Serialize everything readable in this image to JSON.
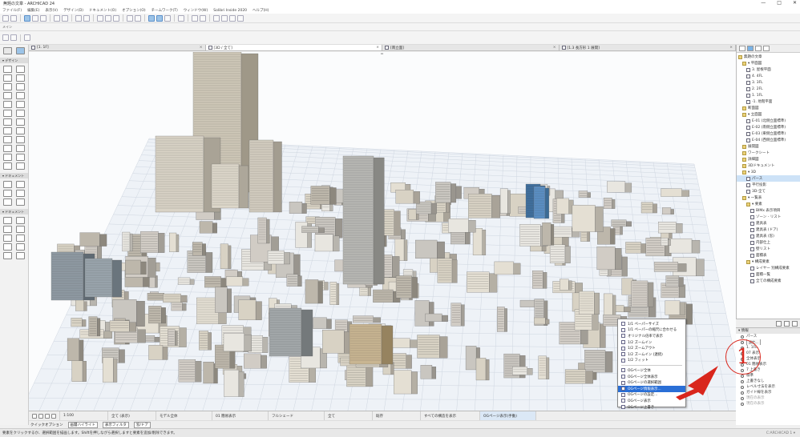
{
  "window": {
    "title": "無題の文章 - ARCHICAD 24",
    "controls": [
      "—",
      "□",
      "✕"
    ]
  },
  "menu": [
    "ファイル(F)",
    "編集(E)",
    "表示(V)",
    "デザイン(D)",
    "ドキュメント(O)",
    "オプション(O)",
    "チームワーク(T)",
    "ウィンドウ(W)",
    "Solibri Inside 2020",
    "ヘルプ(H)"
  ],
  "toolbar_small_label": "メイン",
  "tabs": [
    {
      "label": "[1. 1F]",
      "icon": "floorplan-icon",
      "active": false
    },
    {
      "label": "[3D / 全て]",
      "icon": "3d-icon",
      "active": true
    },
    {
      "label": "[南立面]",
      "icon": "elevation-icon",
      "active": false
    },
    {
      "label": "[1.3 長方形 1 展開]",
      "icon": "interior-elevation-icon",
      "active": false
    }
  ],
  "left_toolbox": {
    "sections": [
      {
        "title": "▾ デザイン",
        "count": 24
      },
      {
        "title": "▾ ドキュメント",
        "count": 6
      },
      {
        "title": "▾ ドキュメント",
        "count": 10
      }
    ]
  },
  "navigator": {
    "items": [
      {
        "label": "無題の文章",
        "indent": 0,
        "icon": "folder",
        "sel": false
      },
      {
        "label": "▾ 平面図",
        "indent": 1,
        "icon": "folder",
        "sel": false
      },
      {
        "label": "3. 屋根平面",
        "indent": 2,
        "icon": "doc",
        "sel": false
      },
      {
        "label": "4. 4FL",
        "indent": 2,
        "icon": "doc",
        "sel": false
      },
      {
        "label": "3. 3FL",
        "indent": 2,
        "icon": "doc",
        "sel": false
      },
      {
        "label": "2. 2FL",
        "indent": 2,
        "icon": "doc",
        "sel": false
      },
      {
        "label": "1. 1FL",
        "indent": 2,
        "icon": "doc",
        "sel": false
      },
      {
        "label": "-1. 地階平面",
        "indent": 2,
        "icon": "doc",
        "sel": false
      },
      {
        "label": "断面図",
        "indent": 1,
        "icon": "folder",
        "sel": false
      },
      {
        "label": "▾ 立面図",
        "indent": 1,
        "icon": "folder",
        "sel": false
      },
      {
        "label": "E-01 (北側立面標準)",
        "indent": 2,
        "icon": "doc",
        "sel": false
      },
      {
        "label": "E-02 (南側立面標準)",
        "indent": 2,
        "icon": "doc",
        "sel": false
      },
      {
        "label": "E-03 (東側立面標準)",
        "indent": 2,
        "icon": "doc",
        "sel": false
      },
      {
        "label": "E-04 (西側立面標準)",
        "indent": 2,
        "icon": "doc",
        "sel": false
      },
      {
        "label": "展開図",
        "indent": 1,
        "icon": "folder",
        "sel": false
      },
      {
        "label": "ワークシート",
        "indent": 1,
        "icon": "folder",
        "sel": false
      },
      {
        "label": "詳細図",
        "indent": 1,
        "icon": "folder",
        "sel": false
      },
      {
        "label": "3Dドキュメント",
        "indent": 1,
        "icon": "folder",
        "sel": false
      },
      {
        "label": "▾ 3D",
        "indent": 1,
        "icon": "folder",
        "sel": false
      },
      {
        "label": "パース",
        "indent": 2,
        "icon": "doc",
        "sel": true
      },
      {
        "label": "平行投影",
        "indent": 2,
        "icon": "doc",
        "sel": false
      },
      {
        "label": "3D-全て",
        "indent": 2,
        "icon": "doc",
        "sel": false
      },
      {
        "label": "▾ 一覧表",
        "indent": 1,
        "icon": "folder",
        "sel": false
      },
      {
        "label": "▾ 要素",
        "indent": 2,
        "icon": "folder",
        "sel": false
      },
      {
        "label": "BIMx 表示項目",
        "indent": 3,
        "icon": "doc",
        "sel": false
      },
      {
        "label": "ゾーン - リスト",
        "indent": 3,
        "icon": "doc",
        "sel": false
      },
      {
        "label": "建具表",
        "indent": 3,
        "icon": "doc",
        "sel": false
      },
      {
        "label": "建具表 (ドア)",
        "indent": 3,
        "icon": "doc",
        "sel": false
      },
      {
        "label": "建具表 (窓)",
        "indent": 3,
        "icon": "doc",
        "sel": false
      },
      {
        "label": "内部仕上",
        "indent": 3,
        "icon": "doc",
        "sel": false
      },
      {
        "label": "壁リスト",
        "indent": 3,
        "icon": "doc",
        "sel": false
      },
      {
        "label": "面積表",
        "indent": 3,
        "icon": "doc",
        "sel": false
      },
      {
        "label": "▾ 構成要素",
        "indent": 2,
        "icon": "folder",
        "sel": false
      },
      {
        "label": "レイヤー 別構成要素",
        "indent": 3,
        "icon": "doc",
        "sel": false
      },
      {
        "label": "面積一覧",
        "indent": 3,
        "icon": "doc",
        "sel": false
      },
      {
        "label": "全ての構成要素",
        "indent": 3,
        "icon": "doc",
        "sel": false
      }
    ]
  },
  "properties": {
    "head": "▾ 情報",
    "rows": [
      {
        "label": "パース",
        "gray": false,
        "button": ""
      },
      {
        "label": "設定...",
        "gray": false,
        "button": "設定..."
      },
      {
        "label": "1. 1FL",
        "gray": false,
        "button": ""
      },
      {
        "label": "07 表示",
        "gray": false,
        "button": ""
      },
      {
        "label": "全体表示",
        "gray": false,
        "button": ""
      },
      {
        "label": "01 簡易表示",
        "gray": false,
        "button": ""
      },
      {
        "label": "7 上書き",
        "gray": false,
        "button": ""
      },
      {
        "label": "標準",
        "gray": false,
        "button": ""
      },
      {
        "label": "上書きなし",
        "gray": false,
        "button": ""
      },
      {
        "label": "レベル寸法を表示",
        "gray": false,
        "button": ""
      },
      {
        "label": "ガイド線を表示",
        "gray": false,
        "button": ""
      },
      {
        "label": "現在の表示",
        "gray": true,
        "button": ""
      },
      {
        "label": "現在の表示",
        "gray": true,
        "button": ""
      }
    ]
  },
  "popup_menu": {
    "group1": [
      "1/1 ペーパーサイズ",
      "1/1 ペーパーの縮尺に合わせる",
      "オリジナル倍率で表示",
      "1/2 ズームイン",
      "1/2 ズームアウト",
      "1/2 ズームイン (連続)",
      "1/2 フィット"
    ],
    "group2": [
      "OGページ全体",
      "OGページ全体表示",
      "OGページの選択範囲",
      "OGページ情報表示...",
      "OGページの設定...",
      "OGページ表示",
      "OGページ上書き"
    ],
    "highlighted": "OGページ情報表示..."
  },
  "bottombar": {
    "zoom": "1:100",
    "scale_label": "1:100",
    "view_label": "全て (表示)",
    "model_view": "モデル全体",
    "plan_label": "01 簡易表示",
    "layer_label": "フルシェード",
    "pen_label": "全て",
    "renovation": "既存",
    "struct_label": "すべての構造を表示",
    "graphic_label": "OGページ表示(手動)"
  },
  "quick_options": {
    "label": "クイックオプション",
    "items": [
      "画層ハイライト",
      "表示フィルタ",
      "窓/ドア"
    ]
  },
  "status": {
    "text": "要素をクリックするか、選択範囲を描画します。Shiftを押しながら選択しますと要素を追加/削除できます。",
    "right": "C:ARCHICAD 1 ▾"
  },
  "annotation": {
    "number": "1"
  },
  "colors": {
    "accent": "#2a6fd6",
    "marker": "#d9261c",
    "grid": "#cfd6e0"
  }
}
